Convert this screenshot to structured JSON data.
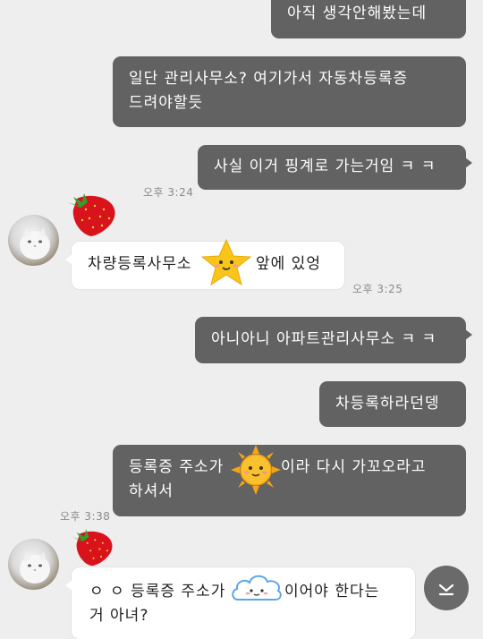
{
  "messages": [
    {
      "dir": "out",
      "lines": [
        "아직 생각안해봤는데"
      ]
    },
    {
      "dir": "out",
      "lines": [
        "일단 관리사무소? 여기가서 자동차등록증",
        "드려야할듯"
      ]
    },
    {
      "dir": "out",
      "lines": [
        "사실 이거 핑계로 가는거임 ㅋ ㅋ"
      ]
    },
    {
      "dir": "in",
      "before": "차량등록사무소",
      "after": "앞에 있엉",
      "emoji": "star-emoticon"
    },
    {
      "dir": "out",
      "lines": [
        "아니아니 아파트관리사무소 ㅋ ㅋ"
      ]
    },
    {
      "dir": "out",
      "lines": [
        "차등록하라던뎅"
      ]
    },
    {
      "dir": "out",
      "line1_before": "등록증 주소가",
      "line1_after": "이라 다시 가꼬오라고",
      "line2": "하셔서",
      "emoji": "sun-emoticon"
    },
    {
      "dir": "in",
      "line1_before": "ㅇ ㅇ 등록증 주소가",
      "line1_after": "이어야 한다는",
      "line2": "거 아녀?",
      "emoji": "cloud-emoticon"
    }
  ],
  "timestamps": {
    "t1": "오후 3:24",
    "t2": "오후 3:25",
    "t3": "오후 3:38"
  },
  "icons": {
    "sticker": "strawberry-icon",
    "scroll": "chevron-down-icon"
  },
  "colors": {
    "background": "#eeeeee",
    "outgoing_bubble": "#626262",
    "incoming_bubble": "#ffffff"
  }
}
